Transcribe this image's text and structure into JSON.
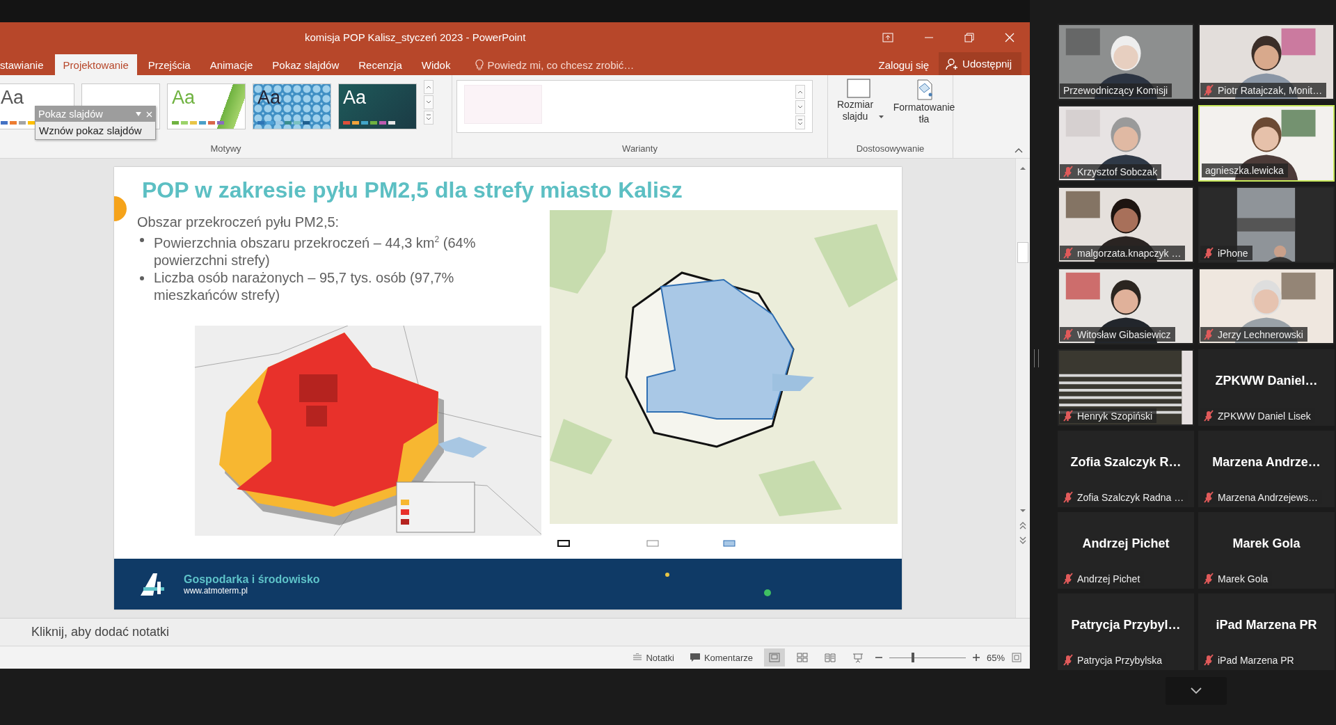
{
  "powerpoint": {
    "title": "komisja POP Kalisz_styczeń 2023 - PowerPoint",
    "tabs": [
      {
        "label": "stawianie",
        "selected": false
      },
      {
        "label": "Projektowanie",
        "selected": true
      },
      {
        "label": "Przejścia",
        "selected": false
      },
      {
        "label": "Animacje",
        "selected": false
      },
      {
        "label": "Pokaz slajdów",
        "selected": false
      },
      {
        "label": "Recenzja",
        "selected": false
      },
      {
        "label": "Widok",
        "selected": false
      }
    ],
    "tell_me": "Powiedz mi, co chcesz zrobić…",
    "sign_in": "Zaloguj się",
    "share": "Udostępnij",
    "themes": [
      {
        "kind": "office",
        "label": "Aa"
      },
      {
        "kind": "plain"
      },
      {
        "kind": "green",
        "label": "Aa"
      },
      {
        "kind": "pattern",
        "label": "Aa"
      },
      {
        "kind": "dark",
        "label": "Aa"
      }
    ],
    "themes_group": "Motywy",
    "variants_group": "Warianty",
    "customize_group": "Dostosowywanie",
    "customize_buttons": [
      {
        "kind": "size",
        "label": "Rozmiar slajdu",
        "dropdown": true
      },
      {
        "kind": "background",
        "label": "Formatowanie tła",
        "dropdown": false
      }
    ],
    "popup": {
      "title": "Pokaz slajdów",
      "action": "Wznów pokaz slajdów"
    },
    "slide": {
      "title": "POP w zakresie pyłu PM2,5 dla strefy miasto Kalisz",
      "intro": "Obszar przekroczeń pyłu PM2,5:",
      "bullets": [
        "Powierzchnia obszaru przekroczeń – 44,3 km$^{2}$ (64% powierzchni strefy)",
        "Liczba osób narażonych – 95,7 tys. osób (97,7% mieszkańców strefy)"
      ],
      "footer_title": "Gospodarka i środowisko",
      "footer_url": "www.atmoterm.pl"
    },
    "notes_placeholder": "Kliknij, aby dodać notatki",
    "status_bar": {
      "notes": "Notatki",
      "comments": "Komentarze",
      "views": [
        {
          "kind": "normal",
          "selected": true
        },
        {
          "kind": "sorter",
          "selected": false
        },
        {
          "kind": "reading",
          "selected": false
        },
        {
          "kind": "show",
          "selected": false
        }
      ],
      "zoom": {
        "level": 0.31,
        "reading": "65%"
      }
    }
  },
  "participants": [
    {
      "name": "Przewodniczący Komisji",
      "video": true,
      "muted": false,
      "speaking": false
    },
    {
      "name": "Piotr Ratajczak, Monit…",
      "video": true,
      "muted": true,
      "speaking": false
    },
    {
      "name": "Krzysztof Sobczak",
      "video": true,
      "muted": true,
      "speaking": false
    },
    {
      "name": "agnieszka.lewicka",
      "video": true,
      "muted": false,
      "speaking": true
    },
    {
      "name": "malgorzata.knapczyk …",
      "video": true,
      "muted": true,
      "speaking": false
    },
    {
      "name": "iPhone",
      "video": true,
      "muted": true,
      "speaking": false
    },
    {
      "name": "Witosław Gibasiewicz",
      "video": true,
      "muted": true,
      "speaking": false
    },
    {
      "name": "Jerzy Lechnerowski",
      "video": true,
      "muted": true,
      "speaking": false
    },
    {
      "name": "Henryk Szopiński",
      "video": true,
      "muted": true,
      "speaking": false
    },
    {
      "name": "ZPKWW Daniel Lisek",
      "display_name": "ZPKWW Daniel…",
      "video": false,
      "muted": true,
      "speaking": false
    },
    {
      "name": "Zofia Szalczyk Radna …",
      "display_name": "Zofia Szalczyk R…",
      "video": false,
      "muted": true,
      "speaking": false
    },
    {
      "name": "Marzena Andrzejews…",
      "display_name": "Marzena Andrze…",
      "video": false,
      "muted": true,
      "speaking": false
    },
    {
      "name": "Andrzej Pichet",
      "display_name": "Andrzej Pichet",
      "video": false,
      "muted": true,
      "speaking": false
    },
    {
      "name": "Marek Gola",
      "display_name": "Marek Gola",
      "video": false,
      "muted": true,
      "speaking": false
    },
    {
      "name": "Patrycja Przybylska",
      "display_name": "Patrycja Przybyl…",
      "video": false,
      "muted": true,
      "speaking": false
    },
    {
      "name": "iPad Marzena PR",
      "display_name": "iPad Marzena PR",
      "video": false,
      "muted": true,
      "speaking": false
    }
  ]
}
